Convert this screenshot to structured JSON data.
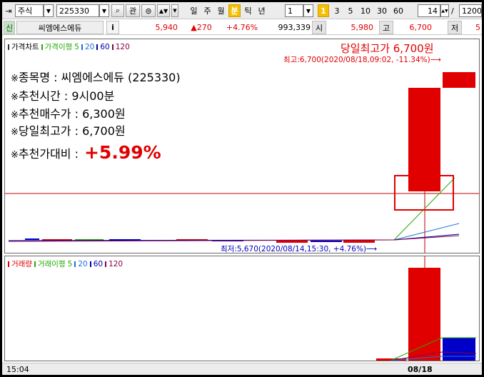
{
  "toolbar": {
    "market_type": "주식",
    "stock_code": "225330",
    "btn_search": "⌕",
    "btn_relation": "관",
    "periods": [
      "일",
      "주",
      "월",
      "분",
      "틱",
      "년"
    ],
    "active_period": "분",
    "period_count": "1",
    "minute_options": [
      "1",
      "3",
      "5",
      "10",
      "30",
      "60"
    ],
    "active_minute": "1",
    "display_count": "14",
    "slash": "/",
    "total_count": "1200"
  },
  "quote": {
    "badge": "신",
    "stock_name": "씨엠에스에듀",
    "info_icon": "i",
    "current_price": "5,940",
    "change": "▲270",
    "change_rate": "+4.76%",
    "volume": "993,339",
    "open_label": "시",
    "open_price": "5,980",
    "high_label": "고",
    "high_price": "6,700",
    "low_label": "저",
    "low_value": "5"
  },
  "price_pane": {
    "legend_title": "가격차트",
    "legend_ma_label": "가격이평",
    "ma_periods": [
      "5",
      "20",
      "60",
      "120"
    ],
    "ma_colors": [
      "#22aa00",
      "#1e6fd9",
      "#0000aa",
      "#8a0045"
    ],
    "high_note": "최고:6,700(2020/08/18,09:02, -11.34%)⟶",
    "low_note": "최저:5,670(2020/08/14,15:30, +4.76%)⟶",
    "headline": "당일최고가 6,700원",
    "info_lines": [
      {
        "mark": "※",
        "text": "종목명 : 씨엠에스에듀 (225330)"
      },
      {
        "mark": "※",
        "text": "추천시간 : 9시00분"
      },
      {
        "mark": "※",
        "text": "추천매수가 : 6,300원"
      },
      {
        "mark": "※",
        "text": "당일최고가 : 6,700원"
      }
    ],
    "ratio_mark": "※",
    "ratio_label": "추천가대비 :",
    "ratio_value": "+5.99%"
  },
  "volume_pane": {
    "legend_title": "거래량",
    "legend_ma_label": "거래이평",
    "ma_periods": [
      "5",
      "20",
      "60",
      "120"
    ]
  },
  "time_axis": {
    "left_time": "15:04",
    "date_label": "08/18"
  },
  "colors": {
    "up": "#e00000",
    "down": "#0000c8",
    "accent": "#f5c000"
  }
}
